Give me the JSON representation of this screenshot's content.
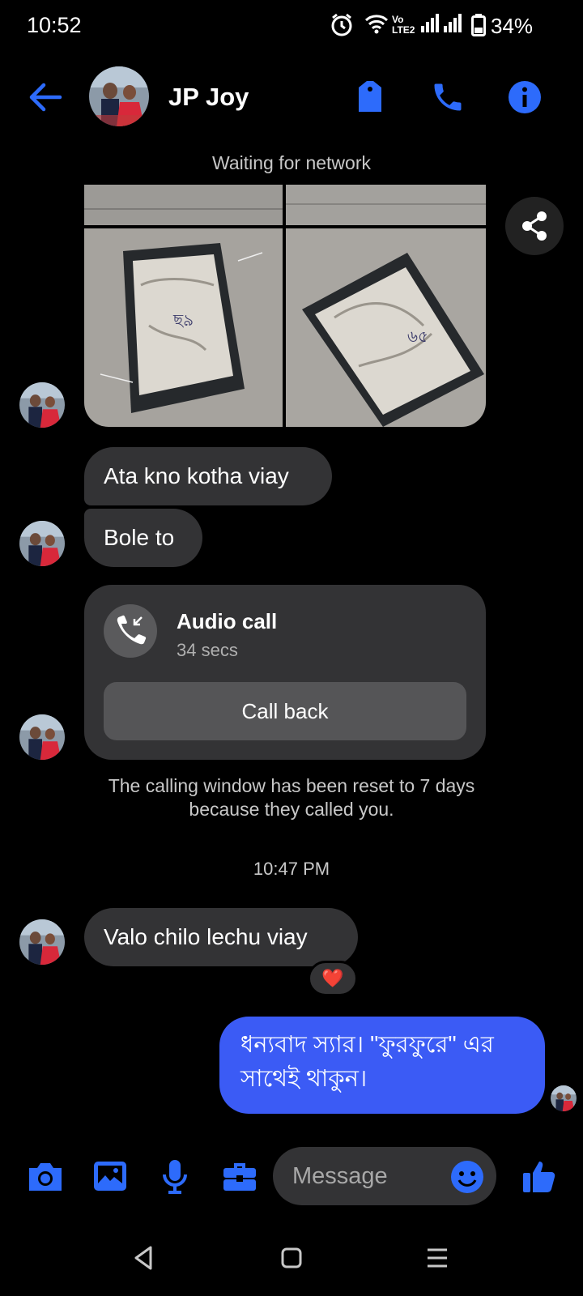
{
  "status_bar": {
    "time": "10:52",
    "network_label": "Vo LTE2",
    "battery": "34%"
  },
  "header": {
    "contact_name": "JP Joy"
  },
  "network_status": "Waiting for network",
  "messages": [
    {
      "text": "Ata kno kotha viay"
    },
    {
      "text": "Bole to"
    },
    {
      "text": "Valo chilo lechu viay"
    }
  ],
  "call": {
    "title": "Audio call",
    "duration": "34 secs",
    "call_back_label": "Call back"
  },
  "notice": "The calling window has been reset to 7 days because they called you.",
  "timestamp": "10:47 PM",
  "reaction": "❤️",
  "outgoing_message": "ধন্যবাদ স্যার। \"ফুরফুরে\" এর সাথেই থাকুন।",
  "composer": {
    "placeholder": "Message"
  },
  "colors": {
    "accent": "#2d6bfb",
    "outgoing_bubble": "#3b5bf5",
    "incoming_bubble": "#333335"
  }
}
